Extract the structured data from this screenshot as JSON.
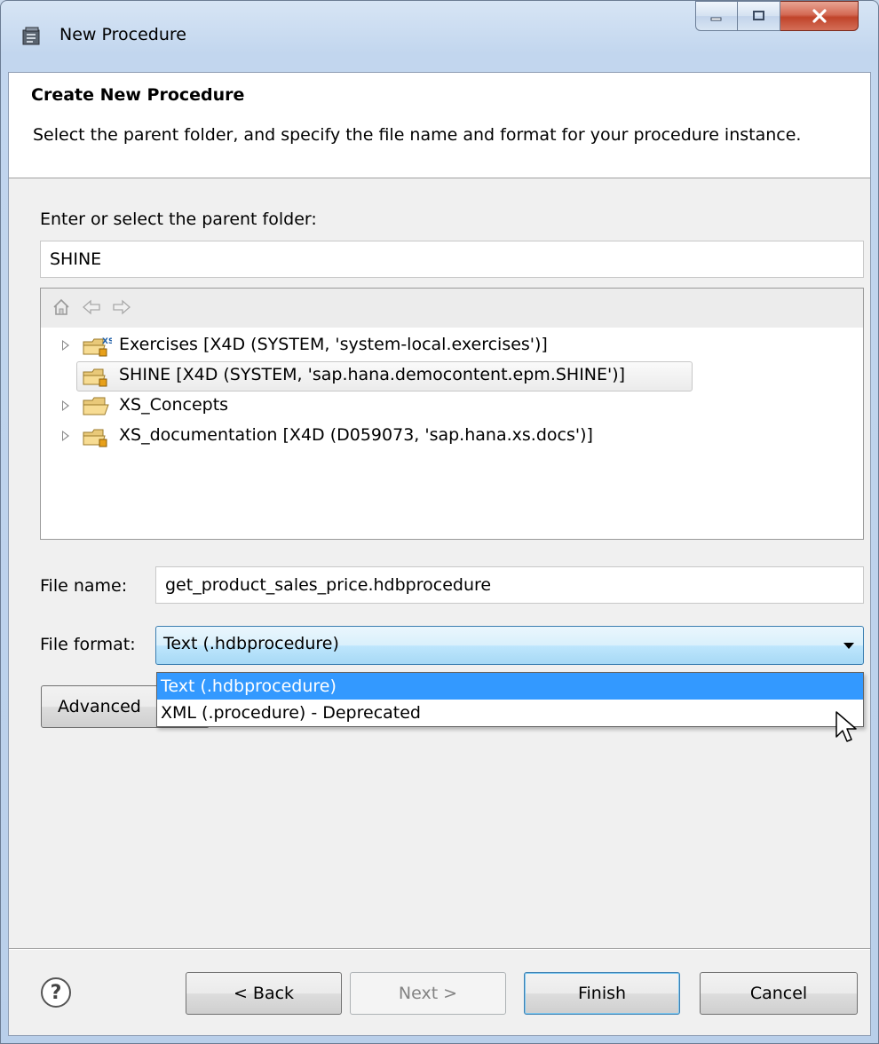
{
  "window": {
    "title": "New Procedure",
    "controls": {
      "minimize": "minimize-icon",
      "maximize": "maximize-icon",
      "close": "close-icon"
    }
  },
  "header": {
    "title": "Create New Procedure",
    "description": "Select the parent folder, and specify the file name and format for your procedure instance."
  },
  "parent_folder": {
    "label": "Enter or select the parent folder:",
    "value": "SHINE"
  },
  "tree": {
    "toolbar": [
      "home-icon",
      "back-arrow-icon",
      "forward-arrow-icon"
    ],
    "items": [
      {
        "label": "Exercises [X4D (SYSTEM, 'system-local.exercises')]",
        "icon": "xs-project-folder-icon",
        "expandable": true,
        "selected": false
      },
      {
        "label": "SHINE [X4D (SYSTEM, 'sap.hana.democontent.epm.SHINE')]",
        "icon": "shared-project-folder-icon",
        "expandable": false,
        "selected": true
      },
      {
        "label": "XS_Concepts",
        "icon": "open-folder-icon",
        "expandable": true,
        "selected": false
      },
      {
        "label": "XS_documentation [X4D (D059073, 'sap.hana.xs.docs')]",
        "icon": "shared-project-folder-icon",
        "expandable": true,
        "selected": false
      }
    ]
  },
  "file_name": {
    "label": "File name:",
    "value": "get_product_sales_price.hdbprocedure"
  },
  "file_format": {
    "label": "File format:",
    "value": "Text (.hdbprocedure)",
    "options": [
      "Text (.hdbprocedure)",
      "XML (.procedure) - Deprecated"
    ],
    "highlighted_index": 0
  },
  "advanced_button": "Advanced",
  "footer": {
    "help": "?",
    "back": "< Back",
    "next": "Next >",
    "finish": "Finish",
    "cancel": "Cancel"
  },
  "colors": {
    "selection": "#3399ff",
    "combo_focus": "#3c7fb1"
  }
}
